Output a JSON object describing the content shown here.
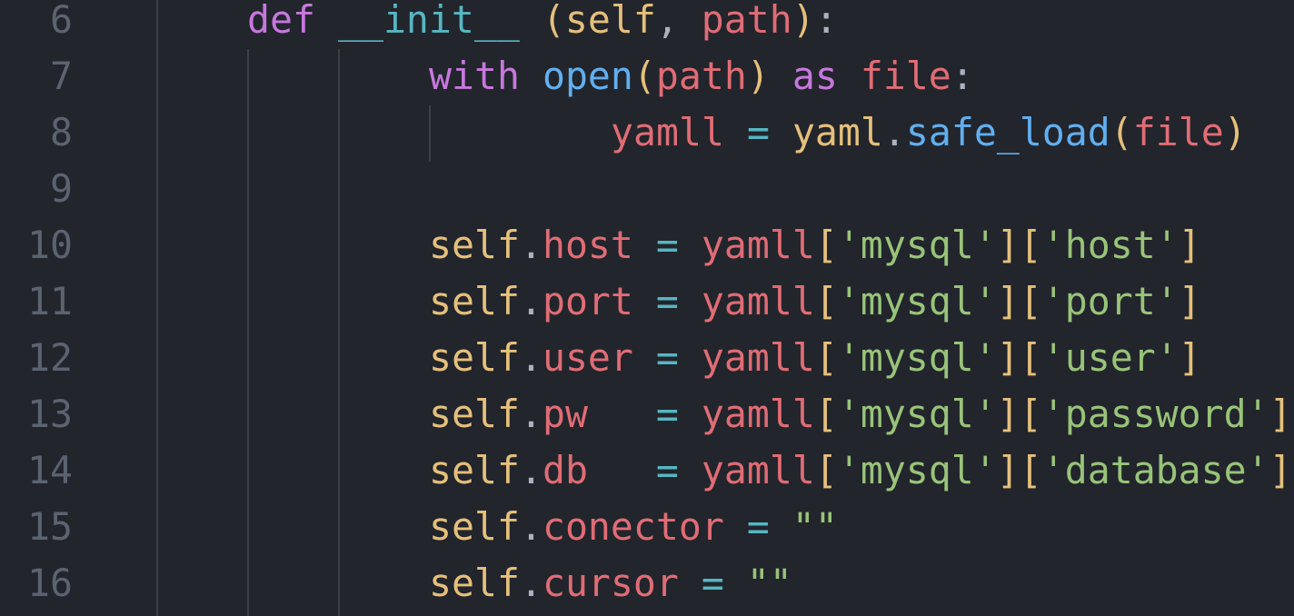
{
  "colors": {
    "background": "#22252c",
    "line_number": "#5c6370",
    "indent_guide": "#3b3f48",
    "keyword": "#c678dd",
    "function": "#61afef",
    "dunder": "#56b6c2",
    "self": "#e5c07b",
    "variable": "#e06c75",
    "string": "#98c379",
    "operator": "#56b6c2",
    "plain": "#abb2bf"
  },
  "line_numbers": [
    "6",
    "7",
    "8",
    "9",
    "10",
    "11",
    "12",
    "13",
    "14",
    "15",
    "16"
  ],
  "lines": [
    {
      "number": "6",
      "indent": 2,
      "tokens": [
        {
          "t": "def",
          "c": "keyword"
        },
        {
          "t": " ",
          "c": "plain"
        },
        {
          "t": "__init__",
          "c": "dunder"
        },
        {
          "t": " ",
          "c": "plain"
        },
        {
          "t": "(",
          "c": "self"
        },
        {
          "t": "self",
          "c": "self"
        },
        {
          "t": ", ",
          "c": "plain"
        },
        {
          "t": "path",
          "c": "variable"
        },
        {
          "t": ")",
          "c": "self"
        },
        {
          "t": ":",
          "c": "plain"
        }
      ]
    },
    {
      "number": "7",
      "indent": 4,
      "tokens": [
        {
          "t": "with",
          "c": "keyword"
        },
        {
          "t": " ",
          "c": "plain"
        },
        {
          "t": "open",
          "c": "function"
        },
        {
          "t": "(",
          "c": "self"
        },
        {
          "t": "path",
          "c": "variable"
        },
        {
          "t": ")",
          "c": "self"
        },
        {
          "t": " ",
          "c": "plain"
        },
        {
          "t": "as",
          "c": "keyword"
        },
        {
          "t": " ",
          "c": "plain"
        },
        {
          "t": "file",
          "c": "variable"
        },
        {
          "t": ":",
          "c": "plain"
        }
      ]
    },
    {
      "number": "8",
      "indent": 6,
      "tokens": [
        {
          "t": "yamll",
          "c": "variable"
        },
        {
          "t": " ",
          "c": "plain"
        },
        {
          "t": "=",
          "c": "operator"
        },
        {
          "t": " ",
          "c": "plain"
        },
        {
          "t": "yaml",
          "c": "self"
        },
        {
          "t": ".",
          "c": "plain"
        },
        {
          "t": "safe_load",
          "c": "function"
        },
        {
          "t": "(",
          "c": "self"
        },
        {
          "t": "file",
          "c": "variable"
        },
        {
          "t": ")",
          "c": "self"
        }
      ]
    },
    {
      "number": "9",
      "indent": 0,
      "tokens": []
    },
    {
      "number": "10",
      "indent": 4,
      "tokens": [
        {
          "t": "self",
          "c": "self"
        },
        {
          "t": ".",
          "c": "plain"
        },
        {
          "t": "host",
          "c": "variable"
        },
        {
          "t": " ",
          "c": "plain"
        },
        {
          "t": "=",
          "c": "operator"
        },
        {
          "t": " ",
          "c": "plain"
        },
        {
          "t": "yamll",
          "c": "variable"
        },
        {
          "t": "[",
          "c": "self"
        },
        {
          "t": "'mysql'",
          "c": "string"
        },
        {
          "t": "]",
          "c": "self"
        },
        {
          "t": "[",
          "c": "self"
        },
        {
          "t": "'host'",
          "c": "string"
        },
        {
          "t": "]",
          "c": "self"
        }
      ]
    },
    {
      "number": "11",
      "indent": 4,
      "tokens": [
        {
          "t": "self",
          "c": "self"
        },
        {
          "t": ".",
          "c": "plain"
        },
        {
          "t": "port",
          "c": "variable"
        },
        {
          "t": " ",
          "c": "plain"
        },
        {
          "t": "=",
          "c": "operator"
        },
        {
          "t": " ",
          "c": "plain"
        },
        {
          "t": "yamll",
          "c": "variable"
        },
        {
          "t": "[",
          "c": "self"
        },
        {
          "t": "'mysql'",
          "c": "string"
        },
        {
          "t": "]",
          "c": "self"
        },
        {
          "t": "[",
          "c": "self"
        },
        {
          "t": "'port'",
          "c": "string"
        },
        {
          "t": "]",
          "c": "self"
        }
      ]
    },
    {
      "number": "12",
      "indent": 4,
      "tokens": [
        {
          "t": "self",
          "c": "self"
        },
        {
          "t": ".",
          "c": "plain"
        },
        {
          "t": "user",
          "c": "variable"
        },
        {
          "t": " ",
          "c": "plain"
        },
        {
          "t": "=",
          "c": "operator"
        },
        {
          "t": " ",
          "c": "plain"
        },
        {
          "t": "yamll",
          "c": "variable"
        },
        {
          "t": "[",
          "c": "self"
        },
        {
          "t": "'mysql'",
          "c": "string"
        },
        {
          "t": "]",
          "c": "self"
        },
        {
          "t": "[",
          "c": "self"
        },
        {
          "t": "'user'",
          "c": "string"
        },
        {
          "t": "]",
          "c": "self"
        }
      ]
    },
    {
      "number": "13",
      "indent": 4,
      "tokens": [
        {
          "t": "self",
          "c": "self"
        },
        {
          "t": ".",
          "c": "plain"
        },
        {
          "t": "pw",
          "c": "variable"
        },
        {
          "t": "   ",
          "c": "plain"
        },
        {
          "t": "=",
          "c": "operator"
        },
        {
          "t": " ",
          "c": "plain"
        },
        {
          "t": "yamll",
          "c": "variable"
        },
        {
          "t": "[",
          "c": "self"
        },
        {
          "t": "'mysql'",
          "c": "string"
        },
        {
          "t": "]",
          "c": "self"
        },
        {
          "t": "[",
          "c": "self"
        },
        {
          "t": "'password'",
          "c": "string"
        },
        {
          "t": "]",
          "c": "self"
        }
      ]
    },
    {
      "number": "14",
      "indent": 4,
      "tokens": [
        {
          "t": "self",
          "c": "self"
        },
        {
          "t": ".",
          "c": "plain"
        },
        {
          "t": "db",
          "c": "variable"
        },
        {
          "t": "   ",
          "c": "plain"
        },
        {
          "t": "=",
          "c": "operator"
        },
        {
          "t": " ",
          "c": "plain"
        },
        {
          "t": "yamll",
          "c": "variable"
        },
        {
          "t": "[",
          "c": "self"
        },
        {
          "t": "'mysql'",
          "c": "string"
        },
        {
          "t": "]",
          "c": "self"
        },
        {
          "t": "[",
          "c": "self"
        },
        {
          "t": "'database'",
          "c": "string"
        },
        {
          "t": "]",
          "c": "self"
        }
      ]
    },
    {
      "number": "15",
      "indent": 4,
      "tokens": [
        {
          "t": "self",
          "c": "self"
        },
        {
          "t": ".",
          "c": "plain"
        },
        {
          "t": "conector",
          "c": "variable"
        },
        {
          "t": " ",
          "c": "plain"
        },
        {
          "t": "=",
          "c": "operator"
        },
        {
          "t": " ",
          "c": "plain"
        },
        {
          "t": "\"\"",
          "c": "string"
        }
      ]
    },
    {
      "number": "16",
      "indent": 4,
      "tokens": [
        {
          "t": "self",
          "c": "self"
        },
        {
          "t": ".",
          "c": "plain"
        },
        {
          "t": "cursor",
          "c": "variable"
        },
        {
          "t": " ",
          "c": "plain"
        },
        {
          "t": "=",
          "c": "operator"
        },
        {
          "t": " ",
          "c": "plain"
        },
        {
          "t": "\"\"",
          "c": "string"
        }
      ]
    }
  ]
}
